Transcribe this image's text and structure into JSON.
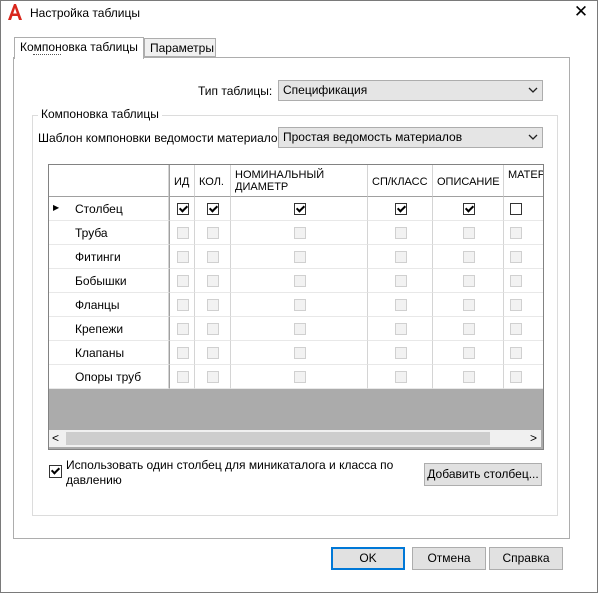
{
  "window": {
    "title": "Настройка таблицы",
    "close_glyph": "✕"
  },
  "tabs": [
    {
      "label": "Компоновка таблицы"
    },
    {
      "label": "Параметры"
    }
  ],
  "table_type": {
    "label": "Тип таблицы:",
    "value": "Спецификация"
  },
  "group": {
    "title": "Компоновка таблицы"
  },
  "template": {
    "label": "Шаблон компоновки ведомости материалов:",
    "value": "Простая ведомость материалов"
  },
  "grid": {
    "columns": [
      {
        "label": "ИД"
      },
      {
        "label": "КОЛ."
      },
      {
        "label": "НОМИНАЛЬНЫЙ ДИАМЕТР"
      },
      {
        "label": "СП/КЛАСС"
      },
      {
        "label": "ОПИСАНИЕ"
      },
      {
        "label": "МАТЕРИАЛ"
      }
    ],
    "rows": [
      {
        "label": "Столбец",
        "checks": [
          true,
          true,
          true,
          true,
          true,
          false
        ],
        "enabled": true
      },
      {
        "label": "Труба",
        "checks": [
          false,
          false,
          false,
          false,
          false,
          false
        ],
        "enabled": false
      },
      {
        "label": "Фитинги",
        "checks": [
          false,
          false,
          false,
          false,
          false,
          false
        ],
        "enabled": false
      },
      {
        "label": "Бобышки",
        "checks": [
          false,
          false,
          false,
          false,
          false,
          false
        ],
        "enabled": false
      },
      {
        "label": "Фланцы",
        "checks": [
          false,
          false,
          false,
          false,
          false,
          false
        ],
        "enabled": false
      },
      {
        "label": "Крепежи",
        "checks": [
          false,
          false,
          false,
          false,
          false,
          false
        ],
        "enabled": false
      },
      {
        "label": "Клапаны",
        "checks": [
          false,
          false,
          false,
          false,
          false,
          false
        ],
        "enabled": false
      },
      {
        "label": "Опоры труб",
        "checks": [
          false,
          false,
          false,
          false,
          false,
          false
        ],
        "enabled": false
      }
    ],
    "current_row_marker": "▶",
    "scroll_left": "<",
    "scroll_right": ">"
  },
  "option": {
    "checked": true,
    "label_line1": "Использовать один столбец для миникаталога и класса по",
    "label_line2": "давлению"
  },
  "buttons": {
    "add_column": "Добавить столбец...",
    "ok": "OK",
    "cancel": "Отмена",
    "help": "Справка"
  },
  "colors": {
    "accent": "#0078d7",
    "app_icon": "#d9261c"
  }
}
